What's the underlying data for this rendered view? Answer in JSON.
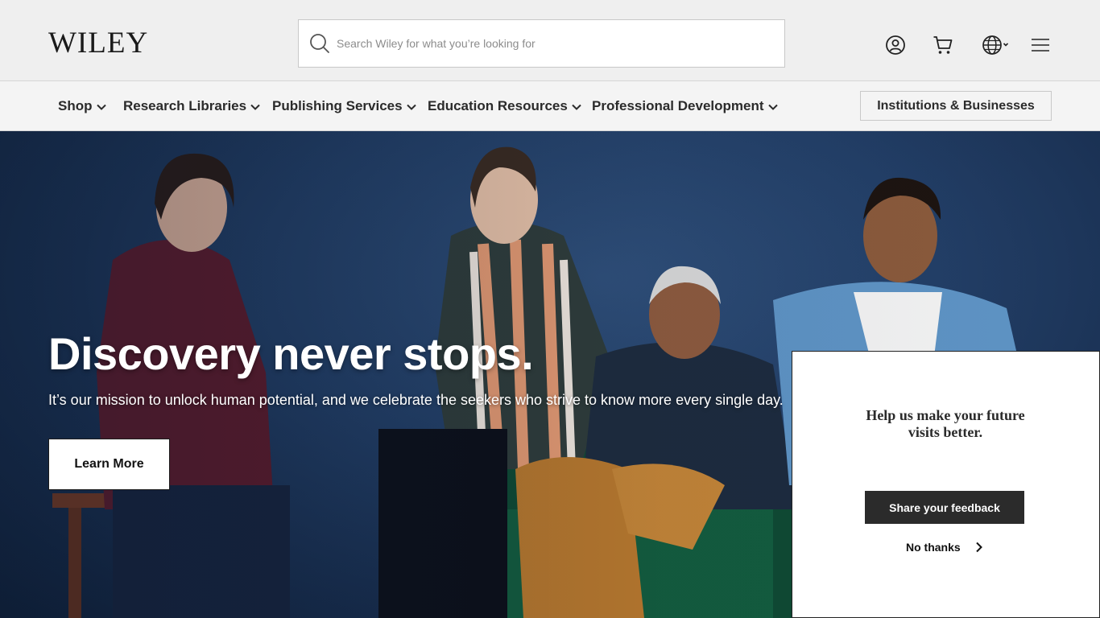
{
  "header": {
    "logo_text": "WILEY",
    "search_placeholder": "Search Wiley for what you’re looking for",
    "icons": [
      "search-icon",
      "account-icon",
      "cart-icon",
      "globe-icon",
      "chevron-down-icon",
      "menu-icon"
    ]
  },
  "nav": {
    "items": [
      {
        "label": "Shop"
      },
      {
        "label": "Research Libraries"
      },
      {
        "label": "Publishing Services"
      },
      {
        "label": "Education Resources"
      },
      {
        "label": "Professional Development"
      }
    ],
    "institutions_label": "Institutions & Businesses"
  },
  "hero": {
    "title": "Discovery never stops.",
    "subtitle": "It’s our mission to unlock human potential, and we celebrate the seekers who strive to know more every single day.",
    "button_label": "Learn More"
  },
  "feedback_popup": {
    "title": "Help us make your future visits better.",
    "share_label": "Share your feedback",
    "dismiss_label": "No thanks"
  },
  "colors": {
    "header_bg": "#efefef",
    "nav_bg": "#f4f4f4",
    "hero_bg": "#223e66",
    "button_dark": "#2b2b2b"
  }
}
